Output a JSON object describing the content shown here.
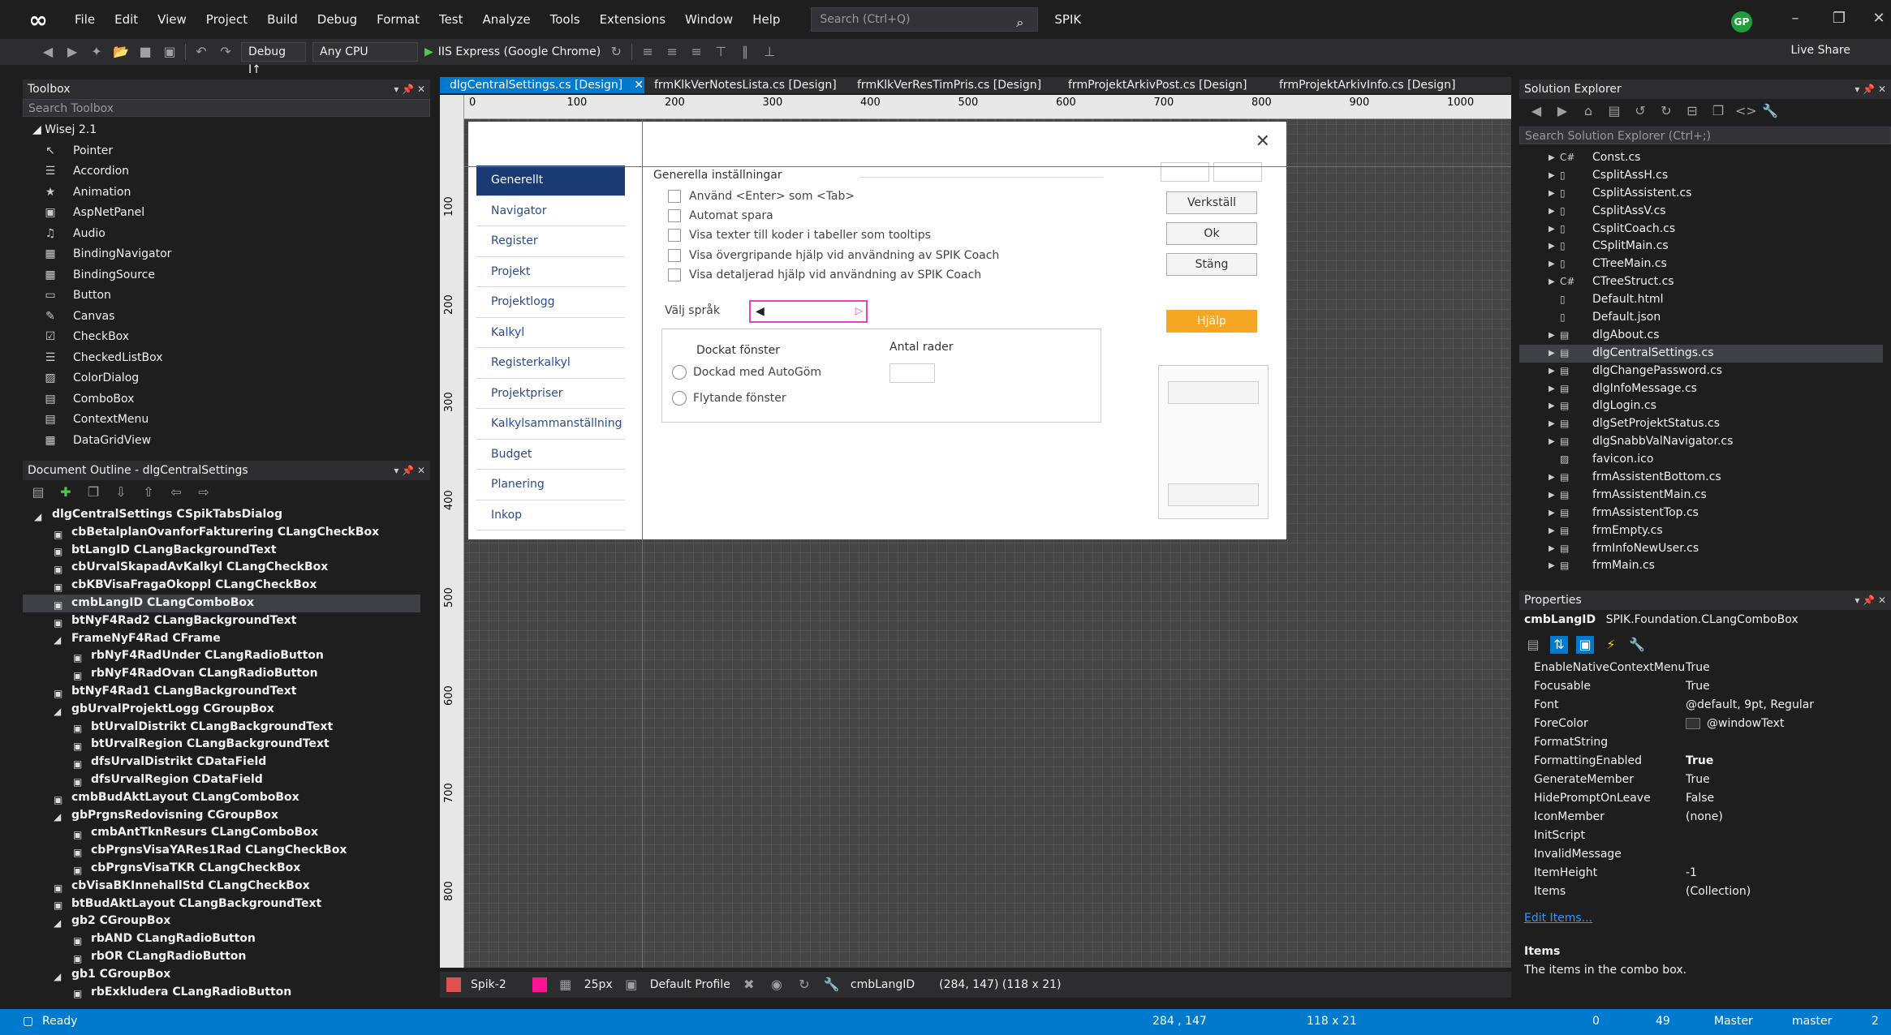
{
  "menu": [
    "File",
    "Edit",
    "View",
    "Project",
    "Build",
    "Debug",
    "Format",
    "Test",
    "Analyze",
    "Tools",
    "Extensions",
    "Window",
    "Help"
  ],
  "search_placeholder": "Search (Ctrl+Q)",
  "solution_name": "SPIK",
  "user_initials": "GP",
  "toolbar": {
    "config": "Debug I↑",
    "platform": "Any CPU",
    "run_target": "IIS Express (Google Chrome)",
    "live_share": "Live Share"
  },
  "toolbox": {
    "title": "Toolbox",
    "search": "Search Toolbox",
    "group": "◢ Wisej 2.1",
    "items": [
      {
        "label": "Pointer",
        "icon": "↖"
      },
      {
        "label": "Accordion",
        "icon": "☰"
      },
      {
        "label": "Animation",
        "icon": "★"
      },
      {
        "label": "AspNetPanel",
        "icon": "▣"
      },
      {
        "label": "Audio",
        "icon": "♫"
      },
      {
        "label": "BindingNavigator",
        "icon": "▦"
      },
      {
        "label": "BindingSource",
        "icon": "▦"
      },
      {
        "label": "Button",
        "icon": "▭"
      },
      {
        "label": "Canvas",
        "icon": "✎"
      },
      {
        "label": "CheckBox",
        "icon": "☑"
      },
      {
        "label": "CheckedListBox",
        "icon": "☰"
      },
      {
        "label": "ColorDialog",
        "icon": "▨"
      },
      {
        "label": "ComboBox",
        "icon": "▤"
      },
      {
        "label": "ContextMenu",
        "icon": "▤"
      },
      {
        "label": "DataGridView",
        "icon": "▦"
      }
    ]
  },
  "outline": {
    "title": "Document Outline - dlgCentralSettings",
    "items": [
      {
        "label": "dlgCentralSettings  CSpikTabsDialog",
        "level": 0
      },
      {
        "label": "cbBetalplanOvanforFakturering  CLangCheckBox",
        "level": 1
      },
      {
        "label": "btLangID  CLangBackgroundText",
        "level": 1
      },
      {
        "label": "cbUrvalSkapadAvKalkyl  CLangCheckBox",
        "level": 1
      },
      {
        "label": "cbKBVisaFragaOkoppl  CLangCheckBox",
        "level": 1
      },
      {
        "label": "cmbLangID  CLangComboBox",
        "level": 1,
        "selected": true
      },
      {
        "label": "btNyF4Rad2  CLangBackgroundText",
        "level": 1
      },
      {
        "label": "FrameNyF4Rad  CFrame",
        "level": 1
      },
      {
        "label": "rbNyF4RadUnder  CLangRadioButton",
        "level": 2
      },
      {
        "label": "rbNyF4RadOvan  CLangRadioButton",
        "level": 2
      },
      {
        "label": "btNyF4Rad1  CLangBackgroundText",
        "level": 1
      },
      {
        "label": "gbUrvalProjektLogg  CGroupBox",
        "level": 1
      },
      {
        "label": "btUrvalDistrikt  CLangBackgroundText",
        "level": 2
      },
      {
        "label": "btUrvalRegion  CLangBackgroundText",
        "level": 2
      },
      {
        "label": "dfsUrvalDistrikt  CDataField",
        "level": 2
      },
      {
        "label": "dfsUrvalRegion  CDataField",
        "level": 2
      },
      {
        "label": "cmbBudAktLayout  CLangComboBox",
        "level": 1
      },
      {
        "label": "gbPrgnsRedovisning  CGroupBox",
        "level": 1
      },
      {
        "label": "cmbAntTknResurs  CLangComboBox",
        "level": 2
      },
      {
        "label": "cbPrgnsVisaYARes1Rad  CLangCheckBox",
        "level": 2
      },
      {
        "label": "cbPrgnsVisaTKR  CLangCheckBox",
        "level": 2
      },
      {
        "label": "cbVisaBKInnehallStd  CLangCheckBox",
        "level": 1
      },
      {
        "label": "btBudAktLayout  CLangBackgroundText",
        "level": 1
      },
      {
        "label": "gb2  CGroupBox",
        "level": 1
      },
      {
        "label": "rbAND  CLangRadioButton",
        "level": 2
      },
      {
        "label": "rbOR  CLangRadioButton",
        "level": 2
      },
      {
        "label": "gb1  CGroupBox",
        "level": 1
      },
      {
        "label": "rbExkludera  CLangRadioButton",
        "level": 2
      }
    ]
  },
  "tabs": [
    {
      "label": "dlgCentralSettings.cs [Design]",
      "active": true
    },
    {
      "label": "frmKlkVerNotesLista.cs [Design]"
    },
    {
      "label": "frmKlkVerResTimPris.cs [Design]"
    },
    {
      "label": "frmProjektArkivPost.cs [Design]"
    },
    {
      "label": "frmProjektArkivInfo.cs [Design]"
    }
  ],
  "ruler_h": [
    "0",
    "100",
    "200",
    "300",
    "400",
    "500",
    "600",
    "700",
    "800",
    "900",
    "1000"
  ],
  "ruler_v": [
    "100",
    "200",
    "300",
    "400",
    "500",
    "600",
    "700",
    "800"
  ],
  "dialog": {
    "nav": [
      "Generellt",
      "Navigator",
      "Register",
      "Projekt",
      "Projektlogg",
      "Kalkyl",
      "Registerkalkyl",
      "Projektpriser",
      "Kalkylsammanställning",
      "Budget",
      "Planering",
      "Inkop"
    ],
    "group_title": "Generella inställningar",
    "checks": [
      "Använd <Enter> som <Tab>",
      "Automat spara",
      "Visa texter till koder i tabeller som tooltips",
      "Visa övergripande hjälp vid användning av SPIK Coach",
      "Visa detaljerad hjälp vid användning av SPIK Coach"
    ],
    "lang_label": "Välj språk",
    "docked_label": "Dockat fönster",
    "radio_autohide": "Dockad med AutoGöm",
    "radio_floating": "Flytande fönster",
    "rows_label": "Antal rader",
    "buttons": {
      "apply": "Verkställ",
      "ok": "Ok",
      "close": "Stäng",
      "help": "Hjälp"
    }
  },
  "designer_bar": {
    "theme": "Spik-2",
    "grid": "25px",
    "profile": "Default Profile",
    "selected": "cmbLangID",
    "info": "(284, 147) (118 x 21)"
  },
  "solution_explorer": {
    "title": "Solution Explorer",
    "search": "Search Solution Explorer (Ctrl+;)",
    "items": [
      {
        "label": "Const.cs",
        "icon": "C#"
      },
      {
        "label": "CsplitAssH.cs",
        "icon": "▯"
      },
      {
        "label": "CsplitAssistent.cs",
        "icon": "▯"
      },
      {
        "label": "CsplitAssV.cs",
        "icon": "▯"
      },
      {
        "label": "CsplitCoach.cs",
        "icon": "▯"
      },
      {
        "label": "CSplitMain.cs",
        "icon": "▯"
      },
      {
        "label": "CTreeMain.cs",
        "icon": "▯"
      },
      {
        "label": "CTreeStruct.cs",
        "icon": "C#"
      },
      {
        "label": "Default.html",
        "icon": "▯"
      },
      {
        "label": "Default.json",
        "icon": "▯"
      },
      {
        "label": "dlgAbout.cs",
        "icon": "▤"
      },
      {
        "label": "dlgCentralSettings.cs",
        "icon": "▤",
        "selected": true
      },
      {
        "label": "dlgChangePassword.cs",
        "icon": "▤"
      },
      {
        "label": "dlgInfoMessage.cs",
        "icon": "▤"
      },
      {
        "label": "dlgLogin.cs",
        "icon": "▤"
      },
      {
        "label": "dlgSetProjektStatus.cs",
        "icon": "▤"
      },
      {
        "label": "dlgSnabbValNavigator.cs",
        "icon": "▤"
      },
      {
        "label": "favicon.ico",
        "icon": "▨"
      },
      {
        "label": "frmAssistentBottom.cs",
        "icon": "▤"
      },
      {
        "label": "frmAssistentMain.cs",
        "icon": "▤"
      },
      {
        "label": "frmAssistentTop.cs",
        "icon": "▤"
      },
      {
        "label": "frmEmpty.cs",
        "icon": "▤"
      },
      {
        "label": "frmInfoNewUser.cs",
        "icon": "▤"
      },
      {
        "label": "frmMain.cs",
        "icon": "▤"
      }
    ]
  },
  "properties": {
    "title": "Properties",
    "object": "cmbLangID",
    "object_type": "SPIK.Foundation.CLangComboBox",
    "rows": [
      {
        "name": "EnableNativeContextMenu",
        "value": "True"
      },
      {
        "name": "Focusable",
        "value": "True"
      },
      {
        "name": "Font",
        "value": "@default, 9pt, Regular"
      },
      {
        "name": "ForeColor",
        "value": "@windowText"
      },
      {
        "name": "FormatString",
        "value": ""
      },
      {
        "name": "FormattingEnabled",
        "value": "True",
        "bold": true
      },
      {
        "name": "GenerateMember",
        "value": "True"
      },
      {
        "name": "HidePromptOnLeave",
        "value": "False"
      },
      {
        "name": "IconMember",
        "value": "(none)"
      },
      {
        "name": "InitScript",
        "value": ""
      },
      {
        "name": "InvalidMessage",
        "value": ""
      },
      {
        "name": "ItemHeight",
        "value": "-1"
      },
      {
        "name": "Items",
        "value": "(Collection)"
      }
    ],
    "link": "Edit Items...",
    "desc_title": "Items",
    "desc_text": "The items in the combo box."
  },
  "status": {
    "ready": "Ready",
    "position": "284 , 147",
    "size": "118 x 21",
    "up": "0",
    "changes": "49",
    "repo": "Master",
    "branch": "master",
    "notifications": "2"
  },
  "colors": {
    "accent": "#007acc",
    "nav_active": "#1a3a73",
    "help": "#f5a623",
    "selection": "#e840c0"
  }
}
